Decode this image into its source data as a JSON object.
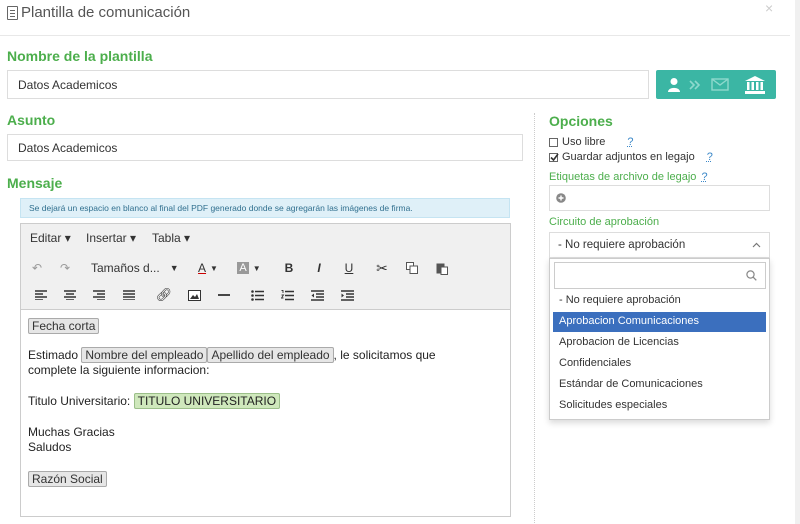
{
  "dialog": {
    "title": "Plantilla de comunicación",
    "close": "×"
  },
  "template_name": {
    "label": "Nombre de la plantilla",
    "value": "Datos Academicos"
  },
  "subject": {
    "label": "Asunto",
    "value": "Datos Academicos"
  },
  "message": {
    "label": "Mensaje",
    "info": "Se dejará un espacio en blanco al final del PDF generado donde se agregarán las imágenes de firma.",
    "menu": [
      "Editar",
      "Insertar",
      "Tabla"
    ],
    "font_size_select": "Tamaños d...",
    "content": {
      "tag_fecha": "Fecha corta",
      "estimado": "Estimado",
      "tag_nombre": "Nombre del empleado",
      "tag_apellido": "Apellido del empleado",
      "text_after": ", le solicitamos que",
      "line2": "complete la siguiente informacion:",
      "titulo_label": "Titulo Universitario:",
      "tag_titulo": "TITULO UNIVERSITARIO",
      "thanks": "Muchas Gracias",
      "saludos": "Saludos",
      "tag_razon": "Razón Social"
    }
  },
  "options": {
    "label": "Opciones",
    "uso_libre": "Uso libre",
    "uso_libre_checked": false,
    "guardar_adjuntos": "Guardar adjuntos en legajo",
    "guardar_adjuntos_checked": true,
    "help": "?",
    "etiquetas_label": "Etiquetas de archivo de legajo",
    "add_icon": "plus-circle-icon",
    "circuito_label": "Circuito de aprobación",
    "circuito_selected": "- No requiere aprobación",
    "circuito_options": [
      "- No requiere aprobación",
      "Aprobacion Comunicaciones",
      "Aprobacion de Licencias",
      "Confidenciales",
      "Estándar de Comunicaciones",
      "Solicitudes especiales"
    ],
    "highlighted_index": 1
  },
  "colors": {
    "accent_green": "#4cae4c",
    "teal_button": "#3bb6a4",
    "highlight_blue": "#3b6fbe"
  }
}
